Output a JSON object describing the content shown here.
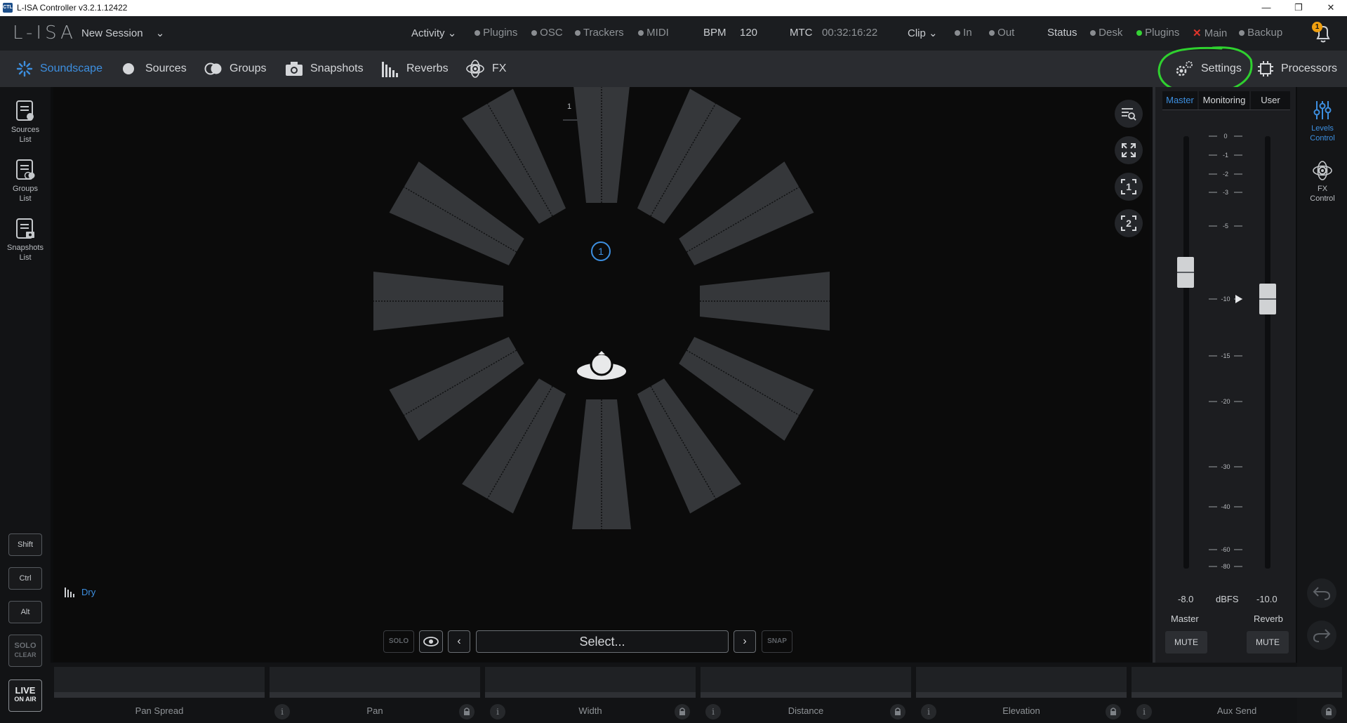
{
  "window": {
    "title": "L-ISA Controller v3.2.1.12422",
    "app_icon_text": "CTL"
  },
  "menubar": {
    "logo": "L-ISA",
    "session": "New Session",
    "activity": "Activity",
    "activity_items": [
      "Plugins",
      "OSC",
      "Trackers",
      "MIDI"
    ],
    "bpm_label": "BPM",
    "bpm_value": "120",
    "mtc_label": "MTC",
    "mtc_value": "00:32:16:22",
    "clip": "Clip",
    "clip_items": [
      "In",
      "Out"
    ],
    "status_label": "Status",
    "status_items": [
      {
        "label": "Desk",
        "state": "idle"
      },
      {
        "label": "Plugins",
        "state": "ok"
      },
      {
        "label": "Main",
        "state": "error"
      },
      {
        "label": "Backup",
        "state": "idle"
      }
    ],
    "notification_count": "1"
  },
  "nav": {
    "tabs": [
      "Soundscape",
      "Sources",
      "Groups",
      "Snapshots",
      "Reverbs",
      "FX"
    ],
    "active": "Soundscape",
    "settings": "Settings",
    "processors": "Processors"
  },
  "leftbar": {
    "items": [
      {
        "line1": "Sources",
        "line2": "List"
      },
      {
        "line1": "Groups",
        "line2": "List"
      },
      {
        "line1": "Snapshots",
        "line2": "List"
      }
    ],
    "keys": [
      "Shift",
      "Ctrl",
      "Alt"
    ],
    "solo_clear": {
      "line1": "SOLO",
      "line2": "CLEAR"
    },
    "live": {
      "line1": "LIVE",
      "line2": "ON AIR"
    }
  },
  "stage": {
    "view_tabs": [
      "1",
      "2"
    ],
    "source_number": "1",
    "dry_label": "Dry",
    "solo_label": "SOLO",
    "select_label": "Select...",
    "snap_label": "SNAP"
  },
  "levels": {
    "tabs": [
      "Master",
      "Monitoring",
      "User"
    ],
    "active_tab": "Master",
    "scale": [
      "0",
      "-1",
      "-2",
      "-3",
      "-5",
      "-10",
      "-15",
      "-20",
      "-30",
      "-40",
      "-60",
      "-80"
    ],
    "master_value": "-8.0",
    "unit": "dBFS",
    "reverb_value": "-10.0",
    "master_label": "Master",
    "reverb_label": "Reverb",
    "mute_label": "MUTE"
  },
  "farright": {
    "levels_control": {
      "line1": "Levels",
      "line2": "Control"
    },
    "fx_control": {
      "line1": "FX",
      "line2": "Control"
    }
  },
  "params": [
    "Pan Spread",
    "Pan",
    "Width",
    "Distance",
    "Elevation",
    "Aux Send"
  ],
  "info_glyph": "i",
  "colors": {
    "accent": "#3d8fe0",
    "highlight_circle": "#2fd12f",
    "ok": "#35d235",
    "error": "#e0352b",
    "badge": "#f0a010"
  }
}
